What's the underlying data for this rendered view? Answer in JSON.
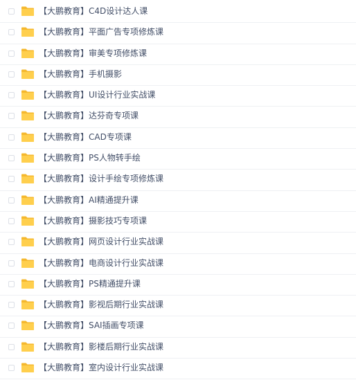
{
  "file_list": {
    "items": [
      {
        "name": "【大鹏教育】C4D设计达人课",
        "icon": "folder-icon"
      },
      {
        "name": "【大鹏教育】平面广告专项修炼课",
        "icon": "folder-icon"
      },
      {
        "name": "【大鹏教育】审美专项修炼课",
        "icon": "folder-icon"
      },
      {
        "name": "【大鹏教育】手机摄影",
        "icon": "folder-icon"
      },
      {
        "name": "【大鹏教育】UI设计行业实战课",
        "icon": "folder-icon"
      },
      {
        "name": "【大鹏教育】达芬奇专项课",
        "icon": "folder-icon"
      },
      {
        "name": "【大鹏教育】CAD专项课",
        "icon": "folder-icon"
      },
      {
        "name": "【大鹏教育】PS人物转手绘",
        "icon": "folder-icon"
      },
      {
        "name": "【大鹏教育】设计手绘专项修炼课",
        "icon": "folder-icon"
      },
      {
        "name": "【大鹏教育】AI精通提升课",
        "icon": "folder-icon"
      },
      {
        "name": "【大鹏教育】摄影技巧专项课",
        "icon": "folder-icon"
      },
      {
        "name": "【大鹏教育】网页设计行业实战课",
        "icon": "folder-icon"
      },
      {
        "name": "【大鹏教育】电商设计行业实战课",
        "icon": "folder-icon"
      },
      {
        "name": "【大鹏教育】PS精通提升课",
        "icon": "folder-icon"
      },
      {
        "name": "【大鹏教育】影视后期行业实战课",
        "icon": "folder-icon"
      },
      {
        "name": "【大鹏教育】SAI插画专项课",
        "icon": "folder-icon"
      },
      {
        "name": "【大鹏教育】影楼后期行业实战课",
        "icon": "folder-icon"
      },
      {
        "name": "【大鹏教育】室内设计行业实战课",
        "icon": "folder-icon"
      }
    ]
  },
  "colors": {
    "folder_body": "#ffcf4d",
    "folder_tab": "#f5b82e",
    "text": "#424e67",
    "divider": "#eef0f3",
    "checkbox_border": "#dcdfe6"
  }
}
